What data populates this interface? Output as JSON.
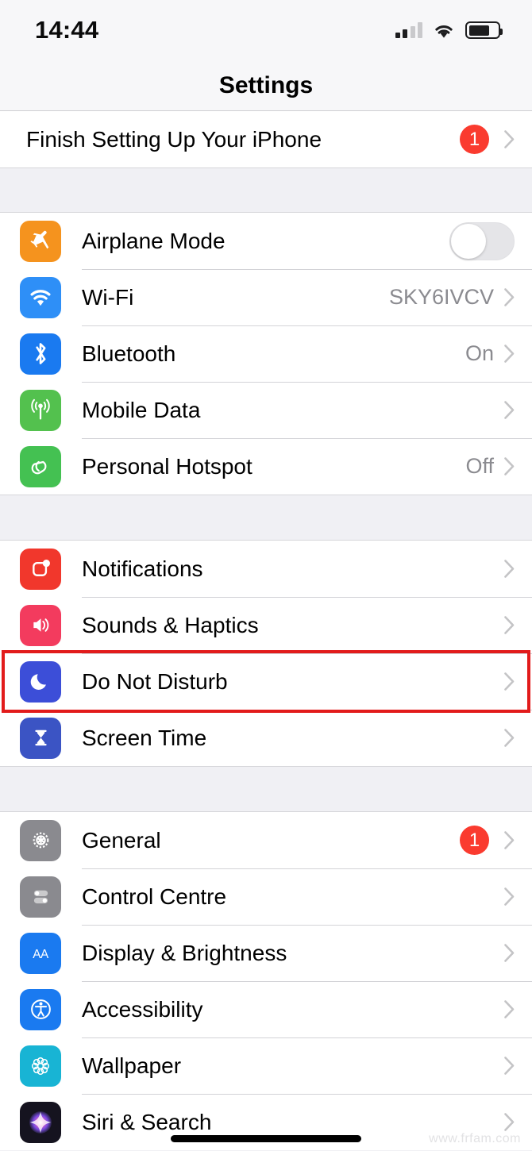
{
  "status_bar": {
    "time": "14:44",
    "signal_icon": "cellular-signal-icon",
    "signal_bars_filled": 2,
    "signal_bars_total": 4,
    "wifi_icon": "wifi-icon",
    "battery_icon": "battery-icon",
    "battery_level_pct": 72
  },
  "nav": {
    "title": "Settings"
  },
  "groups": [
    {
      "id": "setup",
      "rows": [
        {
          "label": "Finish Setting Up Your iPhone",
          "badge": "1",
          "accessory": "chevron",
          "icon": null
        }
      ]
    },
    {
      "id": "connectivity",
      "rows": [
        {
          "label": "Airplane Mode",
          "icon": "airplane-icon",
          "icon_color": "#f5931e",
          "accessory": "toggle",
          "toggle_on": false
        },
        {
          "label": "Wi-Fi",
          "icon": "wifi-icon",
          "icon_color": "#2e8ff7",
          "value": "SKY6IVCV",
          "accessory": "chevron"
        },
        {
          "label": "Bluetooth",
          "icon": "bluetooth-icon",
          "icon_color": "#1a7af0",
          "value": "On",
          "accessory": "chevron"
        },
        {
          "label": "Mobile Data",
          "icon": "cellular-antenna-icon",
          "icon_color": "#53c14e",
          "value": "",
          "accessory": "chevron"
        },
        {
          "label": "Personal Hotspot",
          "icon": "hotspot-link-icon",
          "icon_color": "#44c152",
          "value": "Off",
          "accessory": "chevron"
        }
      ]
    },
    {
      "id": "alerts",
      "rows": [
        {
          "label": "Notifications",
          "icon": "notifications-icon",
          "icon_color": "#f1372c",
          "accessory": "chevron"
        },
        {
          "label": "Sounds & Haptics",
          "icon": "speaker-icon",
          "icon_color": "#f33b5e",
          "accessory": "chevron"
        },
        {
          "label": "Do Not Disturb",
          "icon": "moon-icon",
          "icon_color": "#3c4ed8",
          "accessory": "chevron",
          "highlighted": true
        },
        {
          "label": "Screen Time",
          "icon": "hourglass-icon",
          "icon_color": "#3b54c4",
          "accessory": "chevron"
        }
      ]
    },
    {
      "id": "system",
      "rows": [
        {
          "label": "General",
          "icon": "gear-icon",
          "icon_color": "#8a8a8f",
          "badge": "1",
          "accessory": "chevron"
        },
        {
          "label": "Control Centre",
          "icon": "control-centre-icon",
          "icon_color": "#8a8a8f",
          "accessory": "chevron"
        },
        {
          "label": "Display & Brightness",
          "icon": "display-brightness-icon",
          "icon_color": "#1a7af0",
          "accessory": "chevron"
        },
        {
          "label": "Accessibility",
          "icon": "accessibility-icon",
          "icon_color": "#1a7af0",
          "accessory": "chevron"
        },
        {
          "label": "Wallpaper",
          "icon": "wallpaper-flower-icon",
          "icon_color": "#18b4d4",
          "accessory": "chevron"
        },
        {
          "label": "Siri & Search",
          "icon": "siri-icon",
          "icon_color": "#1b1b2b",
          "accessory": "chevron"
        }
      ]
    }
  ],
  "annotation": {
    "target": "Do Not Disturb",
    "color": "#e21b1b"
  },
  "watermark": "www.frfam.com"
}
